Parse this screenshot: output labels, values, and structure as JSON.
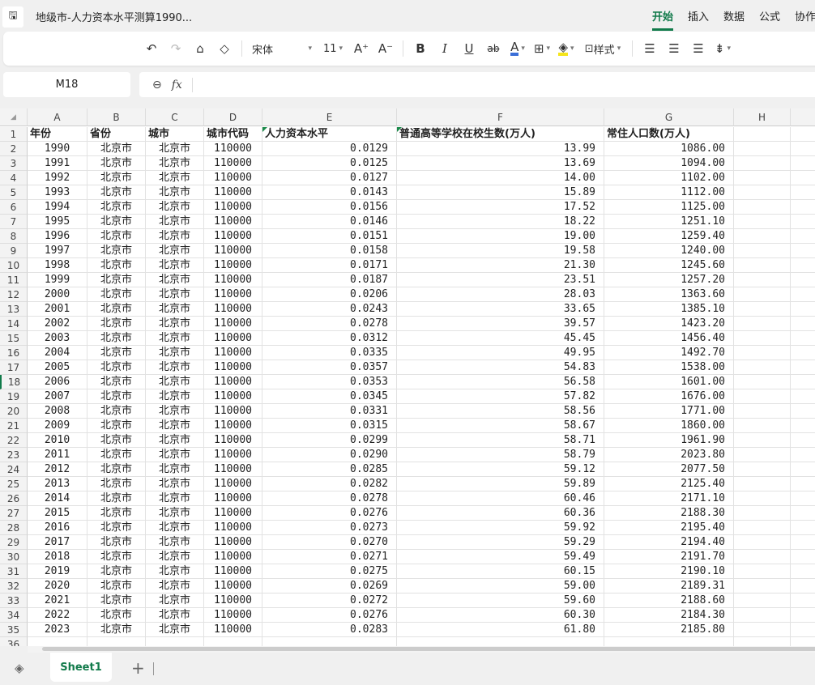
{
  "app": {
    "title": "地级市-人力资本水平测算1990...",
    "save_icon": "save-icon",
    "menu": [
      "开始",
      "插入",
      "数据",
      "公式",
      "协作"
    ],
    "active_menu": "开始"
  },
  "toolbar": {
    "font_name": "宋体",
    "font_size": "11",
    "style_label": "样式",
    "font_color": "#3b6fd8",
    "fill_color": "#f5e51b"
  },
  "formula_bar": {
    "name_box": "M18",
    "fx_label": "fx",
    "value": ""
  },
  "columns": [
    "A",
    "B",
    "C",
    "D",
    "E",
    "F",
    "G",
    "H"
  ],
  "headers": [
    "年份",
    "省份",
    "城市",
    "城市代码",
    "人力资本水平",
    "普通高等学校在校生数(万人)",
    "常住人口数(万人)"
  ],
  "rows": [
    [
      "1990",
      "北京市",
      "北京市",
      "110000",
      "0.0129",
      "13.99",
      "1086.00"
    ],
    [
      "1991",
      "北京市",
      "北京市",
      "110000",
      "0.0125",
      "13.69",
      "1094.00"
    ],
    [
      "1992",
      "北京市",
      "北京市",
      "110000",
      "0.0127",
      "14.00",
      "1102.00"
    ],
    [
      "1993",
      "北京市",
      "北京市",
      "110000",
      "0.0143",
      "15.89",
      "1112.00"
    ],
    [
      "1994",
      "北京市",
      "北京市",
      "110000",
      "0.0156",
      "17.52",
      "1125.00"
    ],
    [
      "1995",
      "北京市",
      "北京市",
      "110000",
      "0.0146",
      "18.22",
      "1251.10"
    ],
    [
      "1996",
      "北京市",
      "北京市",
      "110000",
      "0.0151",
      "19.00",
      "1259.40"
    ],
    [
      "1997",
      "北京市",
      "北京市",
      "110000",
      "0.0158",
      "19.58",
      "1240.00"
    ],
    [
      "1998",
      "北京市",
      "北京市",
      "110000",
      "0.0171",
      "21.30",
      "1245.60"
    ],
    [
      "1999",
      "北京市",
      "北京市",
      "110000",
      "0.0187",
      "23.51",
      "1257.20"
    ],
    [
      "2000",
      "北京市",
      "北京市",
      "110000",
      "0.0206",
      "28.03",
      "1363.60"
    ],
    [
      "2001",
      "北京市",
      "北京市",
      "110000",
      "0.0243",
      "33.65",
      "1385.10"
    ],
    [
      "2002",
      "北京市",
      "北京市",
      "110000",
      "0.0278",
      "39.57",
      "1423.20"
    ],
    [
      "2003",
      "北京市",
      "北京市",
      "110000",
      "0.0312",
      "45.45",
      "1456.40"
    ],
    [
      "2004",
      "北京市",
      "北京市",
      "110000",
      "0.0335",
      "49.95",
      "1492.70"
    ],
    [
      "2005",
      "北京市",
      "北京市",
      "110000",
      "0.0357",
      "54.83",
      "1538.00"
    ],
    [
      "2006",
      "北京市",
      "北京市",
      "110000",
      "0.0353",
      "56.58",
      "1601.00"
    ],
    [
      "2007",
      "北京市",
      "北京市",
      "110000",
      "0.0345",
      "57.82",
      "1676.00"
    ],
    [
      "2008",
      "北京市",
      "北京市",
      "110000",
      "0.0331",
      "58.56",
      "1771.00"
    ],
    [
      "2009",
      "北京市",
      "北京市",
      "110000",
      "0.0315",
      "58.67",
      "1860.00"
    ],
    [
      "2010",
      "北京市",
      "北京市",
      "110000",
      "0.0299",
      "58.71",
      "1961.90"
    ],
    [
      "2011",
      "北京市",
      "北京市",
      "110000",
      "0.0290",
      "58.79",
      "2023.80"
    ],
    [
      "2012",
      "北京市",
      "北京市",
      "110000",
      "0.0285",
      "59.12",
      "2077.50"
    ],
    [
      "2013",
      "北京市",
      "北京市",
      "110000",
      "0.0282",
      "59.89",
      "2125.40"
    ],
    [
      "2014",
      "北京市",
      "北京市",
      "110000",
      "0.0278",
      "60.46",
      "2171.10"
    ],
    [
      "2015",
      "北京市",
      "北京市",
      "110000",
      "0.0276",
      "60.36",
      "2188.30"
    ],
    [
      "2016",
      "北京市",
      "北京市",
      "110000",
      "0.0273",
      "59.92",
      "2195.40"
    ],
    [
      "2017",
      "北京市",
      "北京市",
      "110000",
      "0.0270",
      "59.29",
      "2194.40"
    ],
    [
      "2018",
      "北京市",
      "北京市",
      "110000",
      "0.0271",
      "59.49",
      "2191.70"
    ],
    [
      "2019",
      "北京市",
      "北京市",
      "110000",
      "0.0275",
      "60.15",
      "2190.10"
    ],
    [
      "2020",
      "北京市",
      "北京市",
      "110000",
      "0.0269",
      "59.00",
      "2189.31"
    ],
    [
      "2021",
      "北京市",
      "北京市",
      "110000",
      "0.0272",
      "59.60",
      "2188.60"
    ],
    [
      "2022",
      "北京市",
      "北京市",
      "110000",
      "0.0276",
      "60.30",
      "2184.30"
    ],
    [
      "2023",
      "北京市",
      "北京市",
      "110000",
      "0.0283",
      "61.80",
      "2185.80"
    ]
  ],
  "selected_row": "18",
  "sheets": [
    "Sheet1"
  ],
  "accent": "#117a4a"
}
